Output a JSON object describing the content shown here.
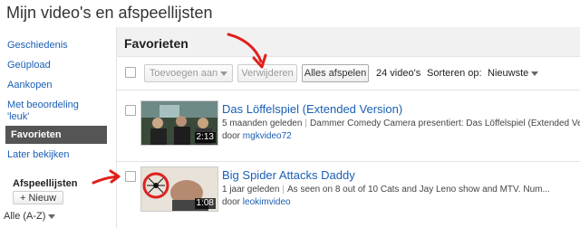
{
  "page": {
    "title": "Mijn video's en afspeellijsten"
  },
  "sidebar": {
    "items": [
      {
        "label": "Geschiedenis"
      },
      {
        "label": "Geüpload"
      },
      {
        "label": "Aankopen"
      },
      {
        "label": "Met beoordeling"
      },
      {
        "label": "'leuk'"
      },
      {
        "label": "Favorieten"
      },
      {
        "label": "Later bekijken"
      }
    ],
    "playlists_heading": "Afspeellijsten",
    "new_button": "+ Nieuw",
    "sort_label": "Alle (A-Z)"
  },
  "main": {
    "title": "Favorieten",
    "toolbar": {
      "add_to": "Toevoegen aan",
      "remove": "Verwijderen",
      "play_all": "Alles afspelen",
      "count": "24 video's",
      "sort_label": "Sorteren op:",
      "sort_value": "Nieuwste"
    },
    "videos": [
      {
        "title": "Das Löffelspiel (Extended Version)",
        "age": "5 maanden geleden",
        "description": "Dammer Comedy Camera presentiert: Das Löffelspiel (Extended Version)",
        "by_prefix": "door",
        "uploader": "mgkvideo72",
        "duration": "2:13"
      },
      {
        "title": "Big Spider Attacks Daddy",
        "age": "1 jaar geleden",
        "description": "As seen on 8 out of 10 Cats and Jay Leno show and MTV. Num...",
        "by_prefix": "door",
        "uploader": "leokimvideo",
        "duration": "1:08"
      }
    ]
  },
  "colors": {
    "link": "#1a5fb4",
    "active_bg": "#555555",
    "annotation_red": "#e0201b"
  }
}
